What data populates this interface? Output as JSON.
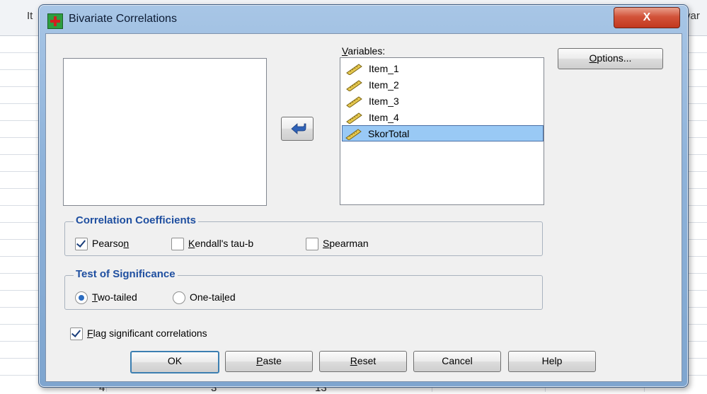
{
  "background": {
    "column_headers": [
      "It",
      "var"
    ],
    "visible_cells": [
      "4",
      "3",
      "13"
    ]
  },
  "dialog": {
    "title": "Bivariate Correlations",
    "close_label": "X"
  },
  "variables": {
    "label": "Variables:",
    "items": [
      {
        "label": "Item_1",
        "selected": false
      },
      {
        "label": "Item_2",
        "selected": false
      },
      {
        "label": "Item_3",
        "selected": false
      },
      {
        "label": "Item_4",
        "selected": false
      },
      {
        "label": "SkorTotal",
        "selected": true
      }
    ]
  },
  "buttons": {
    "options": "Options...",
    "move_arrow_icon": "arrow-left-icon",
    "ok": "OK",
    "paste": "Paste",
    "reset": "Reset",
    "cancel": "Cancel",
    "help": "Help"
  },
  "correlation_coefficients": {
    "title": "Correlation Coefficients",
    "pearson": {
      "label": "Pearson",
      "checked": true
    },
    "kendall": {
      "label": "Kendall's tau-b",
      "checked": false
    },
    "spearman": {
      "label": "Spearman",
      "checked": false
    }
  },
  "test_of_significance": {
    "title": "Test of Significance",
    "two_tailed": {
      "label": "Two-tailed",
      "selected": true
    },
    "one_tailed": {
      "label": "One-tailed",
      "selected": false
    }
  },
  "flag_significant": {
    "label": "Flag significant correlations",
    "checked": true
  },
  "colors": {
    "group_title": "#1f4fa0",
    "selection": "#99c9f5",
    "close_button": "#c2381f"
  }
}
